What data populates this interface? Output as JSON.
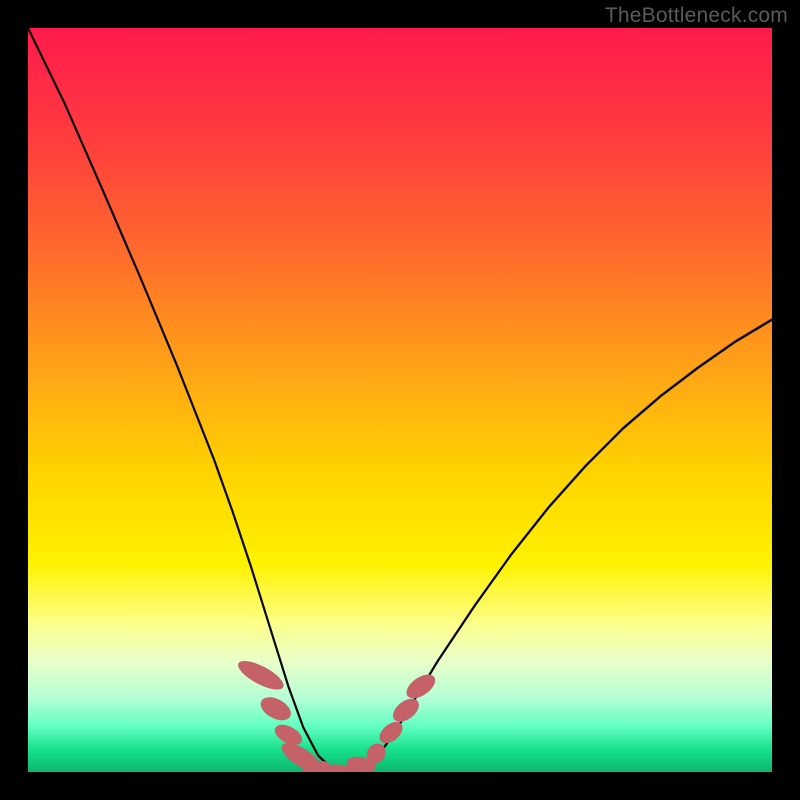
{
  "attribution": "TheBottleneck.com",
  "colors": {
    "curve": "#000000",
    "marker": "#c46169",
    "rim_top": "#390f16",
    "rim_bottom": "#04351f"
  },
  "chart_data": {
    "type": "line",
    "title": "",
    "xlabel": "",
    "ylabel": "",
    "xlim": [
      0,
      1
    ],
    "ylim": [
      0,
      1
    ],
    "grid": false,
    "legend": false,
    "series": [
      {
        "name": "bottleneck-curve",
        "x": [
          0.0,
          0.05,
          0.1,
          0.15,
          0.2,
          0.25,
          0.275,
          0.3,
          0.325,
          0.35,
          0.37,
          0.39,
          0.405,
          0.42,
          0.44,
          0.46,
          0.48,
          0.5,
          0.55,
          0.6,
          0.65,
          0.7,
          0.75,
          0.8,
          0.85,
          0.9,
          0.95,
          1.0
        ],
        "y": [
          1.0,
          0.897,
          0.783,
          0.667,
          0.547,
          0.42,
          0.35,
          0.275,
          0.195,
          0.115,
          0.06,
          0.022,
          0.008,
          0.0,
          0.002,
          0.013,
          0.035,
          0.065,
          0.148,
          0.223,
          0.293,
          0.356,
          0.412,
          0.462,
          0.505,
          0.543,
          0.578,
          0.608
        ]
      }
    ],
    "markers": [
      {
        "cx": 0.313,
        "cy": 0.13,
        "rx": 0.012,
        "ry": 0.034,
        "angle": -62
      },
      {
        "cx": 0.333,
        "cy": 0.085,
        "rx": 0.013,
        "ry": 0.022,
        "angle": -62
      },
      {
        "cx": 0.35,
        "cy": 0.05,
        "rx": 0.011,
        "ry": 0.02,
        "angle": -62
      },
      {
        "cx": 0.367,
        "cy": 0.02,
        "rx": 0.012,
        "ry": 0.03,
        "angle": -58
      },
      {
        "cx": 0.387,
        "cy": 0.004,
        "rx": 0.02,
        "ry": 0.01,
        "angle": -15
      },
      {
        "cx": 0.415,
        "cy": 0.0,
        "rx": 0.03,
        "ry": 0.01,
        "angle": 0
      },
      {
        "cx": 0.448,
        "cy": 0.01,
        "rx": 0.02,
        "ry": 0.01,
        "angle": 10
      },
      {
        "cx": 0.468,
        "cy": 0.025,
        "rx": 0.012,
        "ry": 0.014,
        "angle": 40
      },
      {
        "cx": 0.488,
        "cy": 0.053,
        "rx": 0.011,
        "ry": 0.018,
        "angle": 50
      },
      {
        "cx": 0.508,
        "cy": 0.083,
        "rx": 0.012,
        "ry": 0.02,
        "angle": 52
      },
      {
        "cx": 0.528,
        "cy": 0.115,
        "rx": 0.012,
        "ry": 0.022,
        "angle": 55
      }
    ]
  }
}
